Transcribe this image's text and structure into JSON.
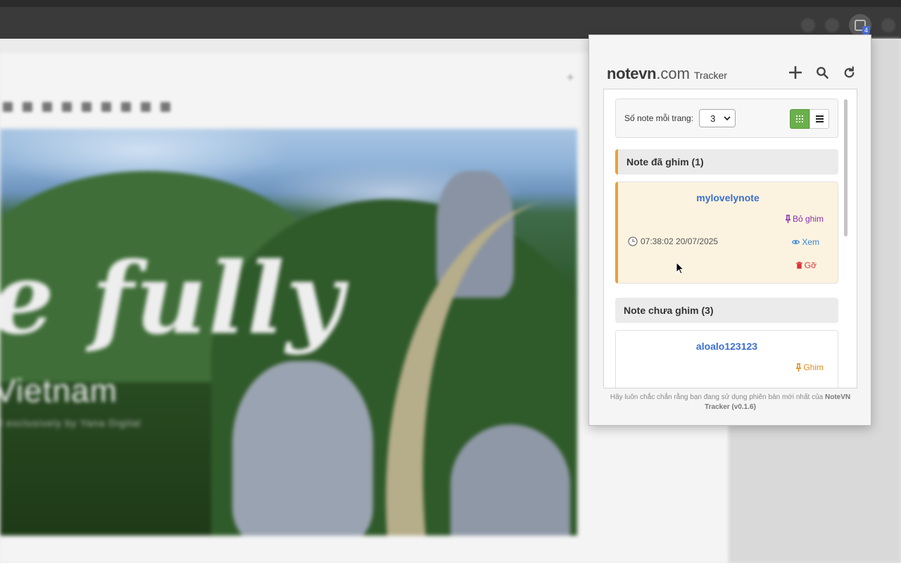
{
  "browser": {
    "extension_badge": "4"
  },
  "background": {
    "hero_script_text": "e fully",
    "hero_country_text": "Vietnam",
    "hero_sub_text": "l exclusively by Yana Digital"
  },
  "popup": {
    "brand_name": "notevn",
    "brand_domain": ".com",
    "brand_tag": "Tracker",
    "actions": {
      "add_icon": "plus-icon",
      "search_icon": "search-icon",
      "refresh_icon": "refresh-icon"
    },
    "controls": {
      "per_page_label": "Số note mỗi trang:",
      "per_page_value": "3",
      "grid_view_icon": "grid-icon",
      "list_view_icon": "list-icon"
    },
    "pinned_section": {
      "title": "Note đã ghim (1)",
      "notes": [
        {
          "name": "mylovelynote",
          "unpin_label": "Bỏ ghim",
          "time": "07:38:02 20/07/2025",
          "view_label": "Xem",
          "remove_label": "Gỡ"
        }
      ]
    },
    "unpinned_section": {
      "title": "Note chưa ghim (3)",
      "notes": [
        {
          "name": "aloalo123123",
          "pin_label": "Ghim"
        }
      ]
    },
    "footer": {
      "text": "Hãy luôn chắc chắn rằng bạn đang sử dụng phiên bản mới nhất của ",
      "product": "NoteVN Tracker (v0.1.6)"
    },
    "colors": {
      "accent_pinned": "#e6a23c",
      "link_blue": "#3b6fd1",
      "grid_active": "#6ab04c",
      "unpin_purple": "#8b2db4",
      "remove_red": "#dd3333"
    }
  }
}
